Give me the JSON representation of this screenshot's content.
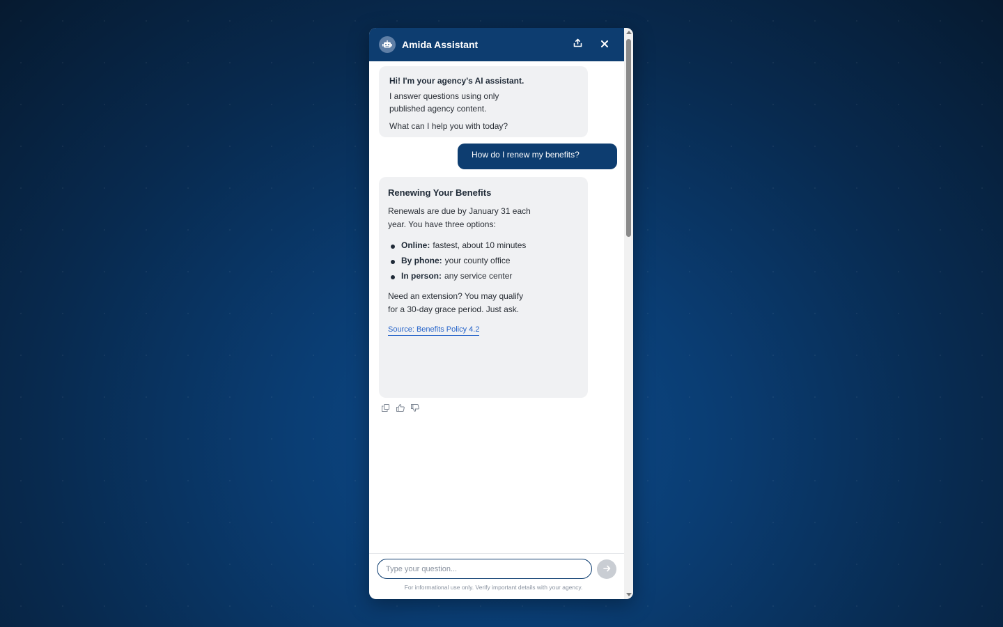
{
  "header": {
    "title": "Amida Assistant",
    "avatar_icon": "robot-icon",
    "share_icon": "share-icon",
    "close_icon": "close-icon"
  },
  "messages": {
    "welcome": {
      "heading": "Hi! I'm your agency's AI assistant.",
      "line1": "I answer questions using only published agency content.",
      "line2": "What can I help you with today?"
    },
    "user_question": "How do I renew my benefits?",
    "answer": {
      "title": "Renewing Your Benefits",
      "intro": "Renewals are due by January 31 each year. You have three options:",
      "options": [
        {
          "label": "Online:",
          "text": "fastest, about 10 minutes"
        },
        {
          "label": "By phone:",
          "text": "your county office"
        },
        {
          "label": "In person:",
          "text": "any service center"
        }
      ],
      "extension": "Need an extension? You may qualify for a 30-day grace period. Just ask.",
      "source": "Source: Benefits Policy 4.2"
    }
  },
  "message_actions": {
    "copy_icon": "copy-icon",
    "thumbs_up_icon": "thumbs-up-icon",
    "thumbs_down_icon": "thumbs-down-icon"
  },
  "composer": {
    "placeholder": "Type your question...",
    "value": "",
    "send_icon": "arrow-right-icon",
    "disclaimer": "For informational use only. Verify important details with your agency."
  },
  "colors": {
    "brand": "#0d3d70",
    "bot_bubble": "#f0f1f3",
    "link": "#2563c9"
  }
}
